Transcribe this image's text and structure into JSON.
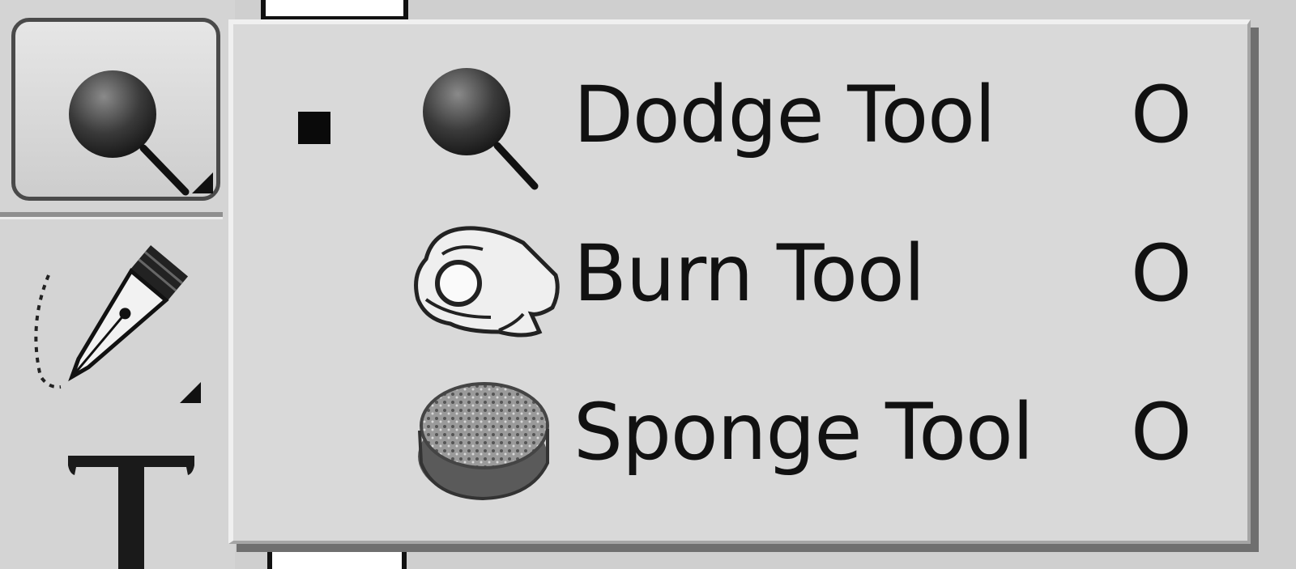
{
  "toolbar": {
    "tools": [
      {
        "name": "Dodge Tool",
        "icon": "dodge-icon",
        "selected": true,
        "has_flyout": true
      },
      {
        "name": "Pen Tool",
        "icon": "pen-icon",
        "selected": false,
        "has_flyout": true
      },
      {
        "name": "Type Tool",
        "icon": "type-icon",
        "selected": false,
        "has_flyout": false
      }
    ]
  },
  "flyout": {
    "items": [
      {
        "label": "Dodge Tool",
        "shortcut": "O",
        "icon": "dodge-icon",
        "checked": true
      },
      {
        "label": "Burn Tool",
        "shortcut": "O",
        "icon": "burn-icon",
        "checked": false
      },
      {
        "label": "Sponge Tool",
        "shortcut": "O",
        "icon": "sponge-icon",
        "checked": false
      }
    ]
  },
  "colors": {
    "menu_bg": "#d9d9d9",
    "panel_bg": "#d4d4d4",
    "text": "#111111",
    "selected_border": "#4a4a4a"
  }
}
